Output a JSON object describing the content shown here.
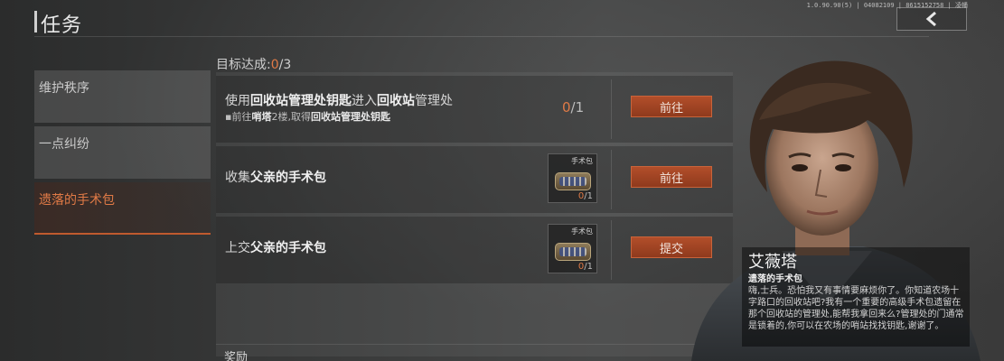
{
  "header": {
    "title": "任务",
    "version": "1.0.90.90(5) | 04082109 | 8615152758 | 凌幡"
  },
  "sidebar": {
    "items": [
      {
        "label": "维护秩序"
      },
      {
        "label": "一点纠纷"
      },
      {
        "label": "遗落的手术包"
      }
    ]
  },
  "goal": {
    "prefix": "目标达成:",
    "done": "0",
    "total": "/3"
  },
  "tasks": [
    {
      "text_parts": [
        "使用",
        "回收站管理处钥匙",
        "进入",
        "回收站",
        "管理处"
      ],
      "sub_bullet": "▪",
      "sub_parts": [
        "前往",
        "哨塔",
        "2楼,取得",
        "回收站管理处钥匙"
      ],
      "progress_cur": "0",
      "progress_total": "/1",
      "button": "前往"
    },
    {
      "text_parts": [
        "收集",
        "父亲的手术包"
      ],
      "item_name": "手术包",
      "item_cur": "0",
      "item_total": "/1",
      "button": "前往"
    },
    {
      "text_parts": [
        "上交",
        "父亲的手术包"
      ],
      "item_name": "手术包",
      "item_cur": "0",
      "item_total": "/1",
      "button": "提交"
    }
  ],
  "rewards_label": "奖励",
  "npc": {
    "name": "艾薇塔",
    "quest": "遗落的手术包",
    "dialog": "嗨,士兵。恐怕我又有事情要麻烦你了。你知道农场十字路口的回收站吧?我有一个重要的高级手术包遗留在那个回收站的管理处,能帮我拿回来么?管理处的门通常是锁着的,你可以在农场的哨站找找钥匙,谢谢了。"
  },
  "icons": {
    "back": "chevron-left-icon",
    "item": "surgical-bag-icon",
    "portrait": "npc-portrait"
  },
  "colors": {
    "accent": "#e07a46",
    "button": "#a3462a"
  }
}
